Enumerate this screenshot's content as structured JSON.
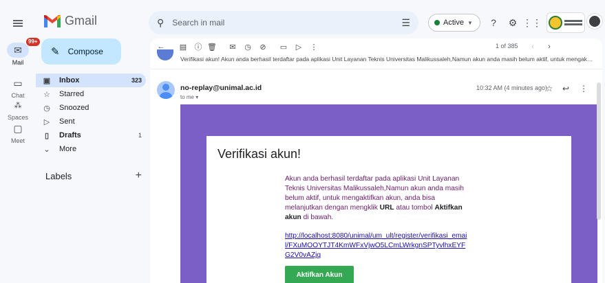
{
  "app": {
    "name": "Gmail"
  },
  "rail": {
    "mail": {
      "label": "Mail",
      "badge": "99+"
    },
    "chat": {
      "label": "Chat"
    },
    "spaces": {
      "label": "Spaces"
    },
    "meet": {
      "label": "Meet"
    }
  },
  "search": {
    "placeholder": "Search in mail"
  },
  "status": {
    "label": "Active",
    "color": "#188038"
  },
  "compose": {
    "label": "Compose"
  },
  "nav": {
    "items": [
      {
        "label": "Inbox",
        "count": "323",
        "icon": "inbox-icon"
      },
      {
        "label": "Starred",
        "count": "",
        "icon": "star-icon"
      },
      {
        "label": "Snoozed",
        "count": "",
        "icon": "clock-icon"
      },
      {
        "label": "Sent",
        "count": "",
        "icon": "send-icon"
      },
      {
        "label": "Drafts",
        "count": "1",
        "icon": "draft-icon"
      },
      {
        "label": "More",
        "count": "",
        "icon": "chevron-down-icon"
      }
    ]
  },
  "labels": {
    "title": "Labels"
  },
  "toolbar": {
    "pager": "1 of 385"
  },
  "thread": {
    "previous_snippet": "Verifikasi akun! Akun anda berhasil terdaftar pada aplikasi Unit Layanan Teknis Universitas Malikussaleh,Namun akun anda masih belum aktif, untuk mengakt…",
    "message": {
      "sender": "no-replay@unimal.ac.id",
      "to": "to me ▾",
      "time": "10:32 AM (4 minutes ago)"
    }
  },
  "email_body": {
    "title": "Verifikasi akun!",
    "paragraph_1": "Akun anda berhasil terdaftar pada aplikasi Unit Layanan Teknis Universitas Malikussaleh,Namun akun anda masih belum aktif, untuk mengaktifkan akun, anda bisa melanjutkan dengan mengklik ",
    "url_word": "URL",
    "paragraph_2": " atau tombol ",
    "button_word": "Aktifkan akun",
    "paragraph_3": " di bawah.",
    "link": "http://localhost:8080/unimal/um_ult/register/verifikasi_email/FXuMOOYTJT4KmWFxVjwO5LCmLWrkgnSPTyvlhxEYFG2V0vAZjq",
    "button_label": "Aktifkan Akun",
    "banner_color": "#7b5fc7",
    "button_color": "#34a853"
  }
}
